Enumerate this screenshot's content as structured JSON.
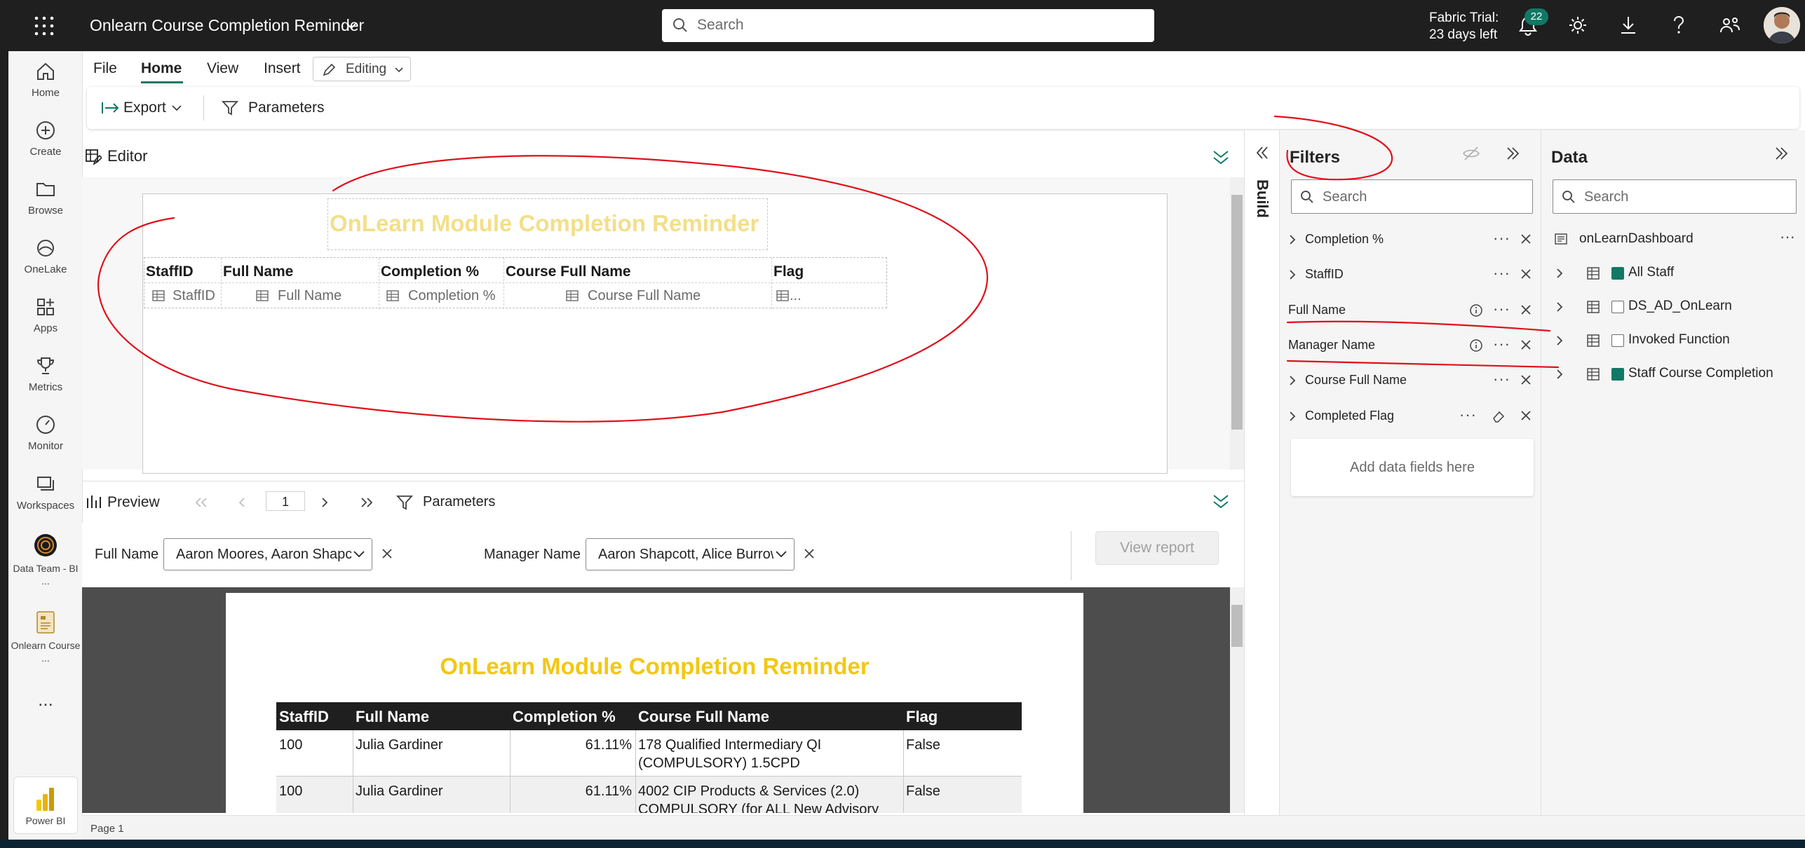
{
  "topbar": {
    "app_title": "Onlearn Course Completion Reminder",
    "search_placeholder": "Search",
    "trial_line1": "Fabric Trial:",
    "trial_line2": "23 days left",
    "notification_count": "22"
  },
  "nav": {
    "items": [
      {
        "label": "Home"
      },
      {
        "label": "Create"
      },
      {
        "label": "Browse"
      },
      {
        "label": "OneLake"
      },
      {
        "label": "Apps"
      },
      {
        "label": "Metrics"
      },
      {
        "label": "Monitor"
      },
      {
        "label": "Workspaces"
      },
      {
        "label": "Data Team - BI ..."
      },
      {
        "label": "Onlearn Course ..."
      }
    ],
    "more": "...",
    "powerbi": "Power BI"
  },
  "menu": {
    "file": "File",
    "home": "Home",
    "view": "View",
    "insert": "Insert",
    "editing": "Editing"
  },
  "toolbar": {
    "export": "Export",
    "parameters": "Parameters"
  },
  "editor": {
    "title": "Editor",
    "report_title": "OnLearn Module Completion Reminder",
    "headers": [
      "StaffID",
      "Full Name",
      "Completion %",
      "Course Full Name",
      "Flag"
    ],
    "fields": [
      "StaffID",
      "Full Name",
      "Completion %",
      "Course Full Name",
      "..."
    ]
  },
  "preview": {
    "title": "Preview",
    "page": "1",
    "parameters": "Parameters",
    "full_name_label": "Full Name",
    "full_name_value": "Aaron Moores, Aaron Shapcott",
    "manager_label": "Manager Name",
    "manager_value": "Aaron Shapcott, Alice Burrows",
    "view_report": "View report",
    "report_title": "OnLearn Module Completion Reminder",
    "headers": [
      "StaffID",
      "Full Name",
      "Completion %",
      "Course Full Name",
      "Flag"
    ],
    "rows": [
      {
        "staffid": "100",
        "name": "Julia Gardiner",
        "pct": "61.11%",
        "course1": "178 Qualified Intermediary QI",
        "course2": "(COMPULSORY)  1.5CPD",
        "flag": "False"
      },
      {
        "staffid": "100",
        "name": "Julia Gardiner",
        "pct": "61.11%",
        "course1": "4002 CIP Products & Services (2.0)",
        "course2": "COMPULSORY (for ALL New Advisory",
        "flag": "False"
      }
    ]
  },
  "status": {
    "page": "Page 1"
  },
  "filters": {
    "title": "Filters",
    "search_placeholder": "Search",
    "items": [
      {
        "name": "Completion %"
      },
      {
        "name": "StaffID"
      },
      {
        "name": "Full Name"
      },
      {
        "name": "Manager Name"
      },
      {
        "name": "Course Full Name"
      },
      {
        "name": "Completed Flag"
      }
    ],
    "add_fields": "Add data fields here"
  },
  "build": {
    "label": "Build"
  },
  "data": {
    "title": "Data",
    "search_placeholder": "Search",
    "dataset": "onLearnDashboard",
    "tables": [
      {
        "name": "All Staff",
        "checked": true
      },
      {
        "name": "DS_AD_OnLearn",
        "checked": false
      },
      {
        "name": "Invoked Function",
        "checked": false
      },
      {
        "name": "Staff Course Completion",
        "checked": true
      }
    ]
  },
  "colors": {
    "accent": "#117865",
    "title_yellow": "#f2c811",
    "topbar": "#1f1f1f",
    "annotation": "#e0101a"
  }
}
